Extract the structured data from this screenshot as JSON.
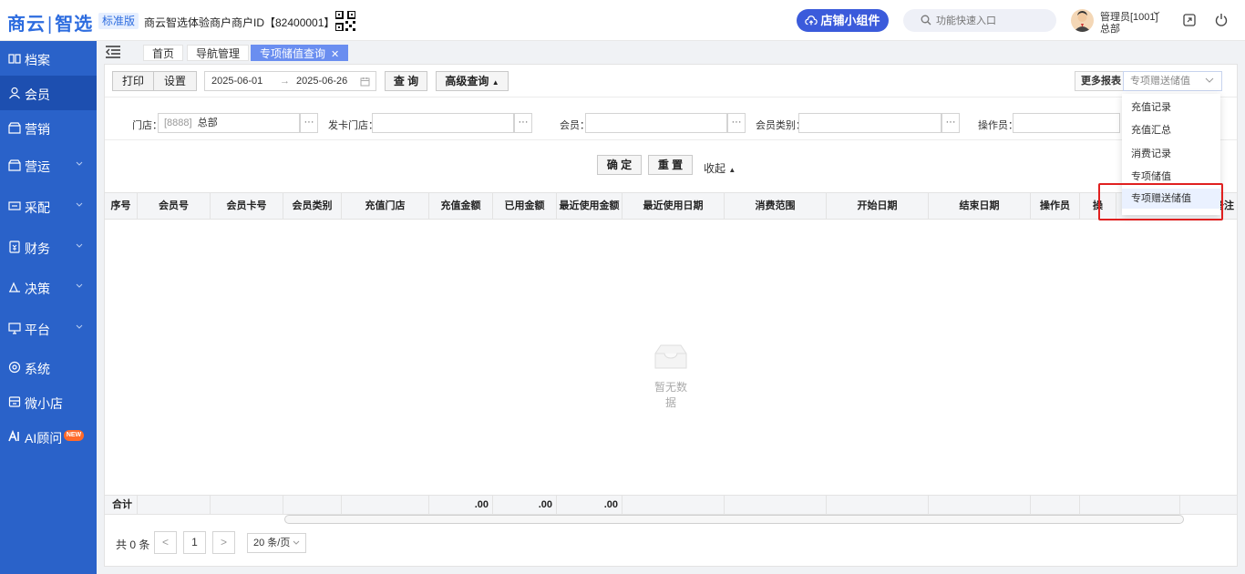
{
  "header": {
    "logo_left": "商云",
    "logo_right": "智选",
    "edition": "标准版",
    "merchant": "商云智选体验商户",
    "merchant_id": "商户ID【82400001】",
    "widget_button": "店铺小组件",
    "search_placeholder": "功能快速入口",
    "user_name": "管理员[1001]",
    "user_org": "总部"
  },
  "sidebar": {
    "items": [
      {
        "label": "档案",
        "icon": "archive-icon"
      },
      {
        "label": "会员",
        "icon": "user-icon"
      },
      {
        "label": "营销",
        "icon": "shop-icon"
      },
      {
        "label": "营运",
        "icon": "shop-icon"
      },
      {
        "label": "采配",
        "icon": "purchase-icon"
      },
      {
        "label": "财务",
        "icon": "finance-icon"
      },
      {
        "label": "决策",
        "icon": "decision-icon"
      },
      {
        "label": "平台",
        "icon": "platform-icon"
      },
      {
        "label": "系统",
        "icon": "settings-icon"
      },
      {
        "label": "微小店",
        "icon": "store-icon"
      },
      {
        "label": "AI顾问",
        "icon": "ai-icon"
      }
    ],
    "new_badge": "NEW"
  },
  "tabs": [
    {
      "label": "首页"
    },
    {
      "label": "导航管理"
    },
    {
      "label": "专项储值查询"
    }
  ],
  "toolbar": {
    "print": "打印",
    "settings": "设置",
    "start_date": "2025-06-01",
    "date_arrow": "→",
    "end_date": "2025-06-26",
    "query": "查 询",
    "advanced": "高级查询",
    "more_reports": "更多报表",
    "report_selected": "专项赠送储值"
  },
  "filters": {
    "store_label": "门店：",
    "store_value_code": "[8888]",
    "store_value_name": "总部",
    "card_store_label": "发卡门店：",
    "member_label": "会员：",
    "member_type_label": "会员类别：",
    "operator_label": "操作员：",
    "more": "···"
  },
  "actions": {
    "confirm": "确 定",
    "reset": "重 置",
    "collapse": "收起"
  },
  "dropdown": {
    "items": [
      "充值记录",
      "充值汇总",
      "消费记录",
      "专项储值",
      "专项赠送储值"
    ]
  },
  "table": {
    "columns": [
      "序号",
      "会员号",
      "会员卡号",
      "会员类别",
      "充值门店",
      "充值金额",
      "已用金额",
      "最近使用金额",
      "最近使用日期",
      "消费范围",
      "开始日期",
      "结束日期",
      "操作员",
      "操",
      "备注"
    ],
    "empty_text": "暂无数据",
    "footer_label": "合计",
    "totals": [
      ".00",
      ".00",
      ".00"
    ]
  },
  "pagination": {
    "total": "共 0 条",
    "prev": "<",
    "page": "1",
    "next": ">",
    "page_size": "20 条/页"
  }
}
